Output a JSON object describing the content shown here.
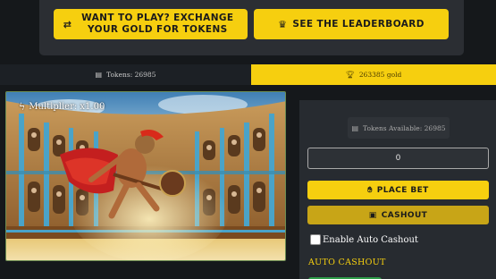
{
  "header": {
    "exchange_label": "WANT TO PLAY? EXCHANGE YOUR GOLD FOR TOKENS",
    "exchange_icon": "exchange-arrows-icon",
    "leaderboard_label": "SEE THE LEADERBOARD",
    "leaderboard_icon": "crown-icon"
  },
  "balances": {
    "tokens_label": "Tokens: 26985",
    "tokens_icon": "coins-icon",
    "gold_label": "263385 gold",
    "gold_icon": "trophy-icon"
  },
  "game": {
    "multiplier_label": "Multiplier: x1.00",
    "multiplier_icon": "lightning-icon",
    "scene": "gladiator-in-colosseum-image"
  },
  "bet_panel": {
    "tokens_available": "Tokens Available: 26985",
    "tokens_available_icon": "coins-icon",
    "bet_value": "0",
    "place_bet_label": "PLACE BET",
    "place_bet_icon": "hand-icon",
    "cashout_label": "CASHOUT",
    "cashout_icon": "wallet-icon",
    "auto_cashout_checkbox_label": "Enable Auto Cashout",
    "auto_cashout_checked": false,
    "auto_cashout_heading": "AUTO CASHOUT"
  },
  "colors": {
    "accent_yellow": "#f6cf0f",
    "cashout_yellow": "#c8a517",
    "page_bg": "#15181b",
    "panel_bg": "#272b30"
  }
}
